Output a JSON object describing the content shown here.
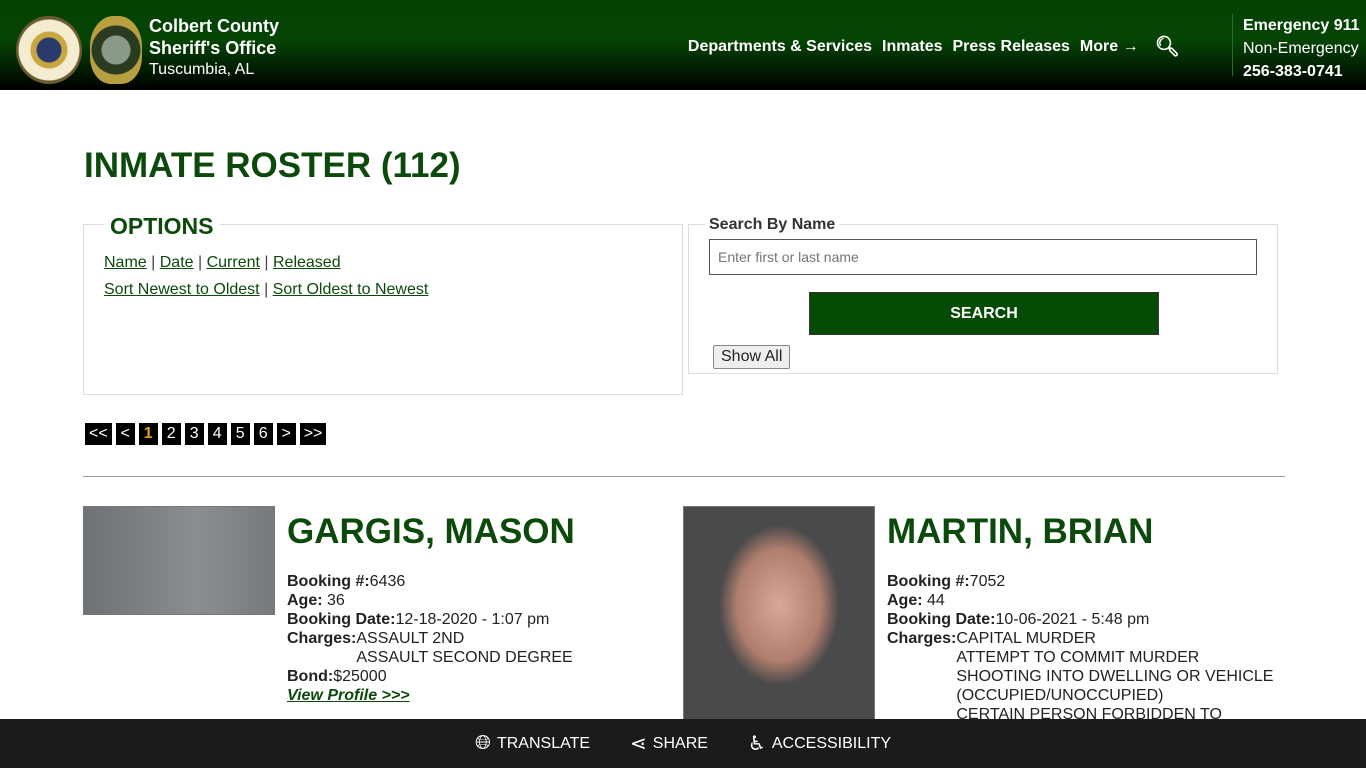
{
  "header": {
    "title": "Colbert County",
    "subtitle": "Sheriff's Office",
    "location": "Tuscumbia, AL",
    "nav": [
      "Departments & Services",
      "Inmates",
      "Press Releases",
      "More"
    ],
    "emergency": "Emergency 911",
    "non_emergency": "Non-Emergency",
    "phone": "256-383-0741"
  },
  "page_title": "INMATE ROSTER (112)",
  "options": {
    "legend": "OPTIONS",
    "filters": [
      "Name",
      "Date",
      "Current",
      "Released"
    ],
    "sorts": [
      "Sort Newest to Oldest",
      "Sort Oldest to Newest"
    ]
  },
  "search": {
    "legend": "Search By Name",
    "placeholder": "Enter first or last name",
    "button": "SEARCH",
    "show_all": "Show All"
  },
  "pager": [
    "<<",
    "<",
    "1",
    "2",
    "3",
    "4",
    "5",
    "6",
    ">",
    ">>"
  ],
  "labels": {
    "booking": "Booking #:",
    "age": "Age:",
    "date": "Booking Date:",
    "charges": "Charges:",
    "bond": "Bond:",
    "view": "View Profile >>>"
  },
  "inmates": [
    {
      "name": "GARGIS, MASON",
      "booking": "6436",
      "age": "36",
      "date": "12-18-2020 - 1:07 pm",
      "charges": [
        "ASSAULT 2ND",
        "ASSAULT SECOND DEGREE"
      ],
      "bond": "$25000"
    },
    {
      "name": "MARTIN, BRIAN",
      "booking": "7052",
      "age": "44",
      "date": "10-06-2021 - 5:48 pm",
      "charges": [
        "CAPITAL MURDER",
        "ATTEMPT TO COMMIT MURDER",
        "SHOOTING INTO DWELLING OR VEHICLE (OCCUPIED/UNOCCUPIED)",
        "CERTAIN PERSON FORBIDDEN TO POSSESS"
      ]
    }
  ],
  "footer": {
    "translate": "TRANSLATE",
    "share": "SHARE",
    "accessibility": "ACCESSIBILITY"
  }
}
